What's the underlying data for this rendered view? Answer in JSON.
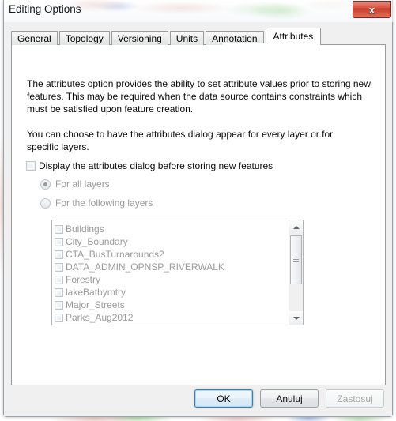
{
  "window": {
    "title": "Editing Options",
    "close_label": "x"
  },
  "tabs": [
    {
      "label": "General",
      "active": false
    },
    {
      "label": "Topology",
      "active": false
    },
    {
      "label": "Versioning",
      "active": false
    },
    {
      "label": "Units",
      "active": false
    },
    {
      "label": "Annotation",
      "active": false
    },
    {
      "label": "Attributes",
      "active": true
    }
  ],
  "attributes_panel": {
    "intro_paragraph": "The attributes option provides the ability to set attribute values prior to storing new features. This may be required when the data source contains constraints which must be satisfied upon feature creation.",
    "choice_paragraph": "You can choose to have the attributes dialog appear for every layer or for specific layers.",
    "display_dialog_checkbox": {
      "label": "Display the attributes dialog before storing new features",
      "checked": false
    },
    "radio_options": [
      {
        "label": "For all layers",
        "selected": true,
        "disabled": true
      },
      {
        "label": "For the following layers",
        "selected": false,
        "disabled": true
      }
    ],
    "layer_list": [
      {
        "label": "Buildings",
        "checked": false
      },
      {
        "label": "City_Boundary",
        "checked": false
      },
      {
        "label": "CTA_BusTurnarounds2",
        "checked": false
      },
      {
        "label": "DATA_ADMIN_OPNSP_RIVERWALK",
        "checked": false
      },
      {
        "label": "Forestry",
        "checked": false
      },
      {
        "label": "lakeBathymtry",
        "checked": false
      },
      {
        "label": "Major_Streets",
        "checked": false
      },
      {
        "label": "Parks_Aug2012",
        "checked": false
      }
    ]
  },
  "footer": {
    "ok_label": "OK",
    "cancel_label": "Anuluj",
    "apply_label": "Zastosuj"
  },
  "colors": {
    "default_button_border": "#3c7fb1",
    "close_button": "#c33a27",
    "disabled_text": "#9a9a9a",
    "dialog_background": "#f0f0f0"
  }
}
